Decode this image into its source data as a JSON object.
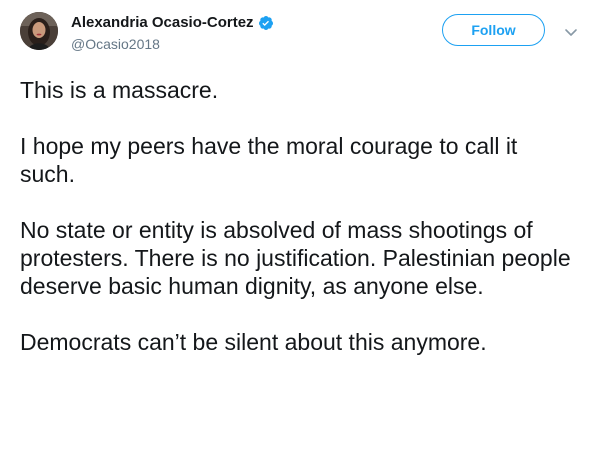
{
  "colors": {
    "link_blue": "#1da1f2",
    "text_primary": "#14171a",
    "text_secondary": "#657786",
    "caret": "#8899a6"
  },
  "user": {
    "display_name": "Alexandria Ocasio-Cortez",
    "username": "@Ocasio2018",
    "verified_icon": "verified-badge-icon",
    "avatar": "profile-photo"
  },
  "actions": {
    "follow_label": "Follow",
    "menu_icon": "chevron-down-icon"
  },
  "tweet": {
    "paragraphs": [
      "This is a massacre.",
      "I hope my peers have the moral courage to call it such.",
      "No state or entity is absolved of mass shootings of protesters. There is no justification. Palestinian people deserve basic human dignity, as anyone else.",
      "Democrats can’t be silent about this anymore."
    ]
  }
}
